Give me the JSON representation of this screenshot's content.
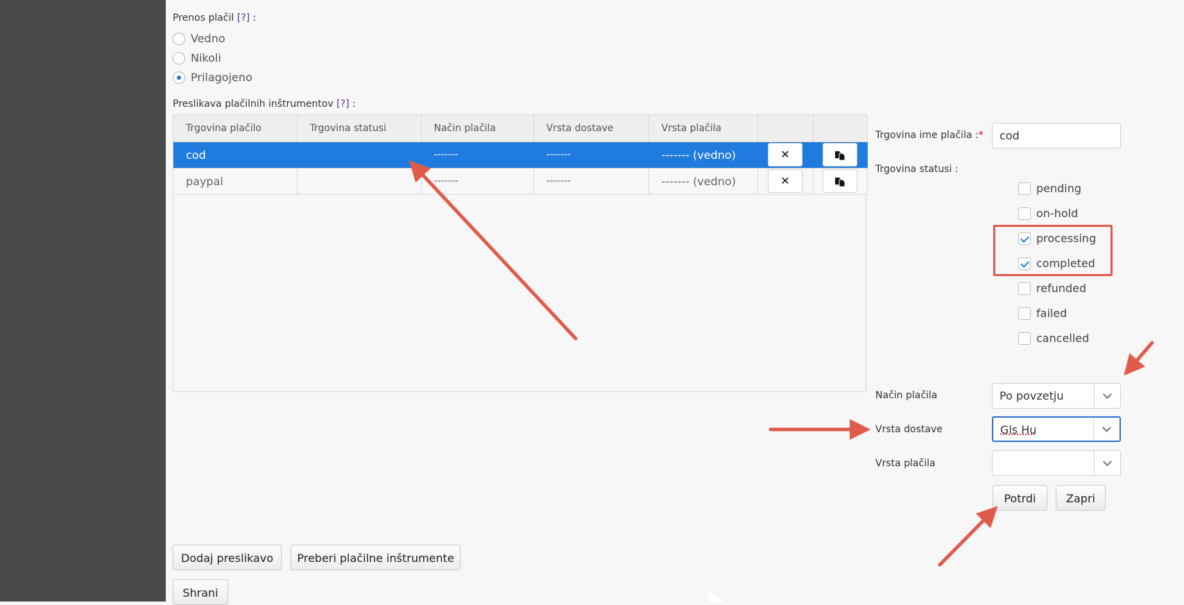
{
  "payment_transfer": {
    "label": "Prenos plačil",
    "help": "[?]",
    "colon": ":",
    "options": [
      {
        "label": "Vedno",
        "checked": false
      },
      {
        "label": "Nikoli",
        "checked": false
      },
      {
        "label": "Prilagojeno",
        "checked": true
      }
    ]
  },
  "mapping": {
    "label": "Preslikava plačilnih inštrumentov",
    "help": "[?]",
    "colon": ":",
    "columns": [
      "Trgovina plačilo",
      "Trgovina statusi",
      "Način plačila",
      "Vrsta dostave",
      "Vrsta plačila"
    ],
    "rows": [
      {
        "payment": "cod",
        "statuses": "",
        "method": "-------",
        "delivery": "-------",
        "type": "------- (vedno)",
        "selected": true
      },
      {
        "payment": "paypal",
        "statuses": "",
        "method": "-------",
        "delivery": "-------",
        "type": "------- (vedno)",
        "selected": false
      }
    ],
    "delete_icon": "close-icon",
    "copy_icon": "copy-icon"
  },
  "editor": {
    "name_label": "Trgovina ime plačila :",
    "required_mark": "*",
    "name_value": "cod",
    "statuses_label": "Trgovina statusi :",
    "statuses": [
      {
        "label": "pending",
        "checked": false
      },
      {
        "label": "on-hold",
        "checked": false
      },
      {
        "label": "processing",
        "checked": true
      },
      {
        "label": "completed",
        "checked": true
      },
      {
        "label": "refunded",
        "checked": false
      },
      {
        "label": "failed",
        "checked": false
      },
      {
        "label": "cancelled",
        "checked": false
      }
    ],
    "method_label": "Način plačila",
    "method_value": "Po povzetju",
    "delivery_label": "Vrsta dostave",
    "delivery_value": "Gls Hu",
    "type_label": "Vrsta plačila",
    "type_value": "",
    "confirm": "Potrdi",
    "close": "Zapri"
  },
  "actions": {
    "add_mapping": "Dodaj preslikavo",
    "read_instruments": "Preberi plačilne inštrumente",
    "save": "Shrani"
  },
  "colors": {
    "selected_row": "#1f7bde",
    "annotation": "#e05b4a",
    "gutter": "#4a4a4a"
  }
}
